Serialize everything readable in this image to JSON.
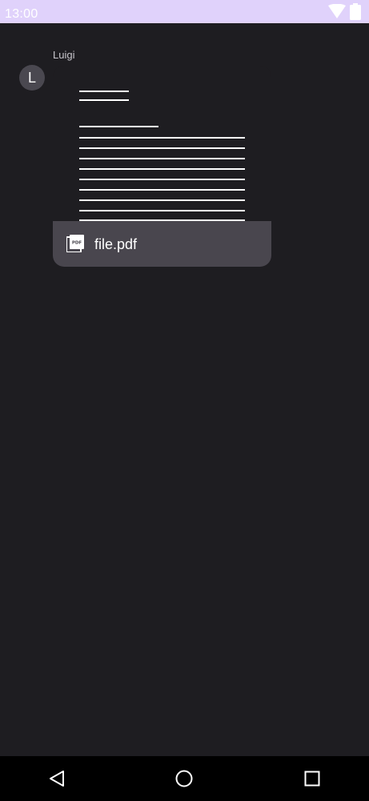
{
  "status_bar": {
    "time": "13:00",
    "icons": [
      "wifi-icon",
      "battery-icon"
    ]
  },
  "message": {
    "sender": "Luigi",
    "avatar_initial": "L",
    "attachment": {
      "file_name": "file.pdf",
      "file_type_icon": "pdf-icon"
    }
  },
  "navigation": {
    "buttons": [
      "back-button",
      "home-button",
      "recents-button"
    ]
  },
  "colors": {
    "background": "#1e1d21",
    "status_bar": "#e0d2fb",
    "file_bar": "#49464e",
    "avatar": "#4a4850"
  }
}
